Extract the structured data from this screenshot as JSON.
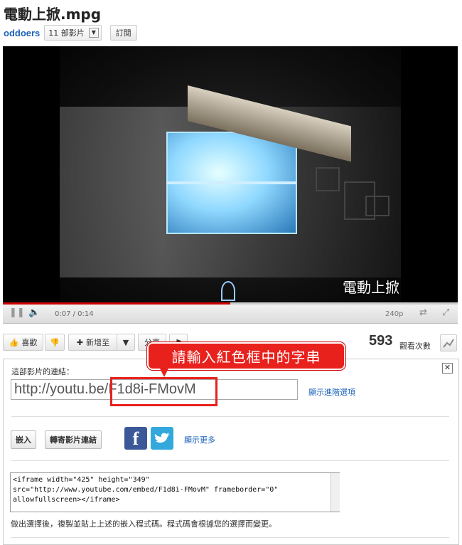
{
  "video": {
    "title": "電動上掀.mpg",
    "caption": "電動上掀"
  },
  "channel": {
    "name": "oddoers",
    "video_count": "11 部影片",
    "subscribe_label": "訂閱"
  },
  "player": {
    "time": "0:07 / 0:14",
    "quality": "240p",
    "progress": 0.5
  },
  "actions": {
    "like_label": "喜歡",
    "add_to_label": "新增至",
    "share_label": "分享",
    "views_count": "593",
    "views_label": "觀看次數"
  },
  "callout": {
    "text": "請輸入紅色框中的字串"
  },
  "share_panel": {
    "link_label": "這部影片的連結：",
    "url": "http://youtu.be/F1d8i-FMovM",
    "advanced_link": "顯示進階選項",
    "embed_button": "嵌入",
    "email_button": "轉寄影片連結",
    "more_link": "顯示更多",
    "embed_code": "<iframe width=\"425\" height=\"349\"\nsrc=\"http://www.youtube.com/embed/F1d8i-FMovM\" frameborder=\"0\"\nallowfullscreen></iframe>",
    "hint": "做出選擇後，複製並貼上上述的嵌入程式碼。程式碼會根據您的選擇而變更。"
  },
  "colors": {
    "link_blue": "#1c62b9",
    "highlight_red": "#e8211d",
    "facebook": "#3b5998",
    "twitter": "#33a8dc"
  }
}
